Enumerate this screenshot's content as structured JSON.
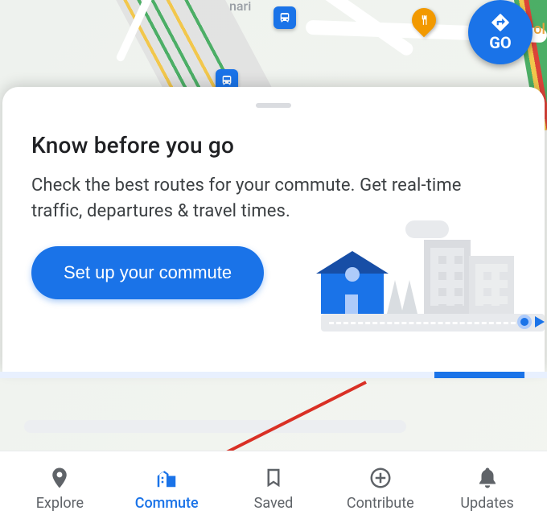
{
  "map": {
    "go_label": "GO",
    "street_labels": {
      "top": "nari",
      "right": "ol"
    }
  },
  "sheet": {
    "title": "Know before you go",
    "subtitle": "Check the best routes for your commute. Get real-time traffic, departures & travel times.",
    "cta_label": "Set up your commute"
  },
  "nav": {
    "items": [
      {
        "id": "explore",
        "label": "Explore",
        "active": false
      },
      {
        "id": "commute",
        "label": "Commute",
        "active": true
      },
      {
        "id": "saved",
        "label": "Saved",
        "active": false
      },
      {
        "id": "contribute",
        "label": "Contribute",
        "active": false
      },
      {
        "id": "updates",
        "label": "Updates",
        "active": false
      }
    ]
  },
  "colors": {
    "primary": "#1a73e8",
    "text": "#202124",
    "muted": "#5f6368"
  }
}
